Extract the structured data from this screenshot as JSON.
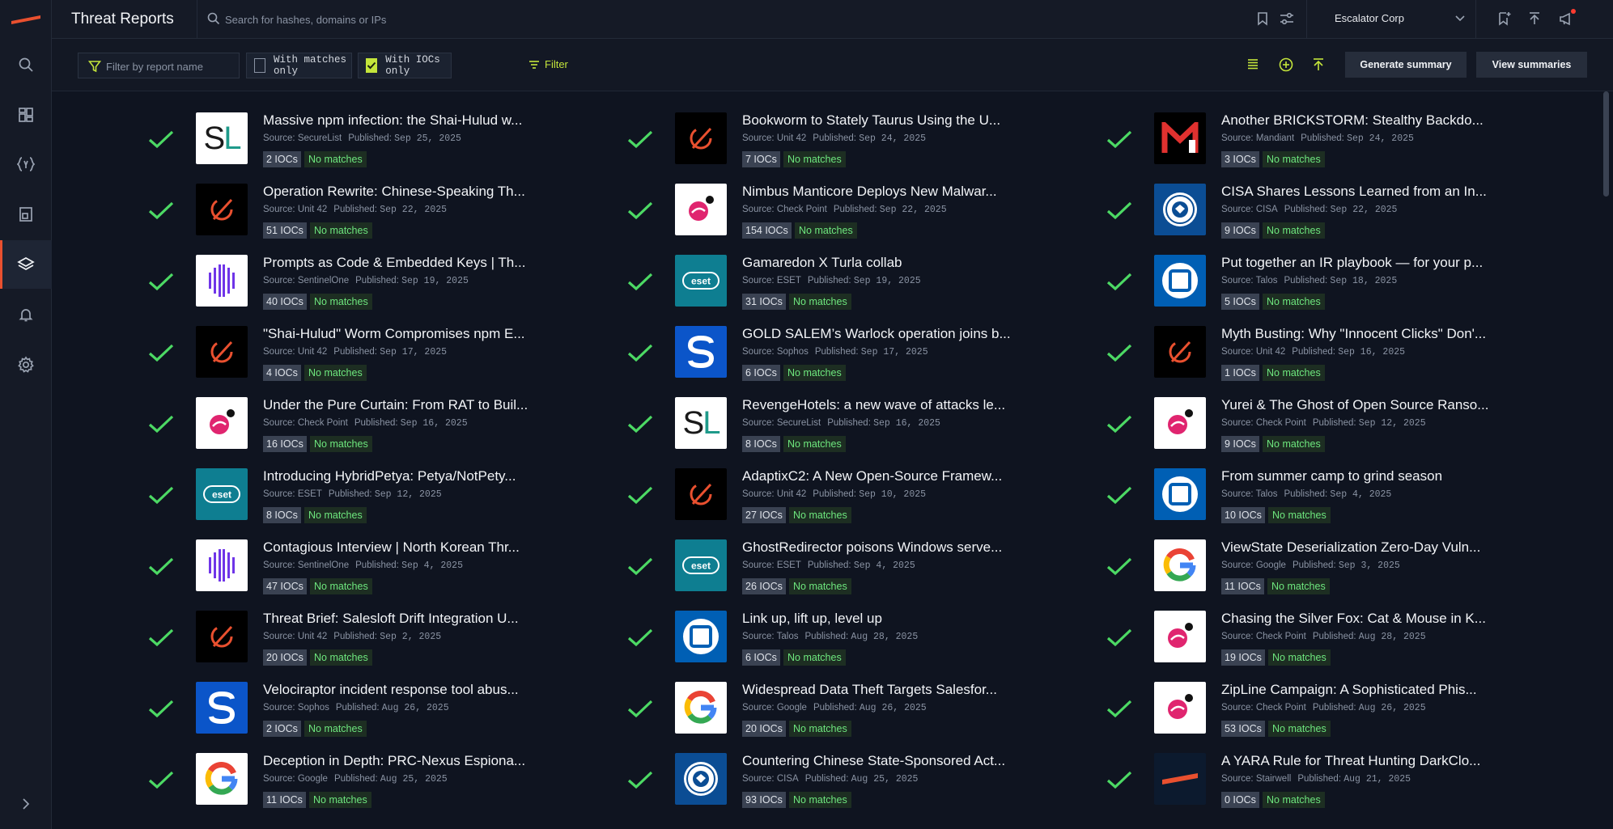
{
  "app": {
    "title": "Threat Reports",
    "search_placeholder": "Search for hashes, domains or IPs",
    "org_name": "Escalator Corp"
  },
  "nav": [
    "search-icon",
    "dashboard-icon",
    "rules-icon",
    "reports-icon",
    "layers-icon",
    "bell-icon",
    "gear-icon"
  ],
  "filters": {
    "report_name_placeholder": "Filter by report name",
    "with_matches_label": "With matches only",
    "with_matches_checked": false,
    "with_iocs_label": "With IOCs only",
    "with_iocs_checked": true,
    "filter_label": "Filter",
    "generate_summary_label": "Generate summary",
    "view_summaries_label": "View summaries"
  },
  "colors": {
    "accent": "#c4e53b",
    "check": "#4cd964",
    "no_match": "#6ee77e",
    "brand": "#e9502f"
  },
  "published_label": "Published:",
  "source_label": "Source:",
  "reports": [
    [
      {
        "title": "Massive npm infection: the Shai-Hulud w...",
        "source": "SecureList",
        "published": "Sep 25, 2025",
        "iocs": "2 IOCs",
        "matches": "No matches",
        "logo": "sl"
      },
      {
        "title": "Operation Rewrite: Chinese-Speaking Th...",
        "source": "Unit 42",
        "published": "Sep 22, 2025",
        "iocs": "51 IOCs",
        "matches": "No matches",
        "logo": "u42"
      },
      {
        "title": "Prompts as Code & Embedded Keys | Th...",
        "source": "SentinelOne",
        "published": "Sep 19, 2025",
        "iocs": "40 IOCs",
        "matches": "No matches",
        "logo": "s1"
      },
      {
        "title": "\"Shai-Hulud\" Worm Compromises npm E...",
        "source": "Unit 42",
        "published": "Sep 17, 2025",
        "iocs": "4 IOCs",
        "matches": "No matches",
        "logo": "u42"
      },
      {
        "title": "Under the Pure Curtain: From RAT to Buil...",
        "source": "Check Point",
        "published": "Sep 16, 2025",
        "iocs": "16 IOCs",
        "matches": "No matches",
        "logo": "cp"
      },
      {
        "title": "Introducing HybridPetya: Petya/NotPety...",
        "source": "ESET",
        "published": "Sep 12, 2025",
        "iocs": "8 IOCs",
        "matches": "No matches",
        "logo": "eset"
      },
      {
        "title": "Contagious Interview | North Korean Thr...",
        "source": "SentinelOne",
        "published": "Sep 4, 2025",
        "iocs": "47 IOCs",
        "matches": "No matches",
        "logo": "s1"
      },
      {
        "title": "Threat Brief: Salesloft Drift Integration U...",
        "source": "Unit 42",
        "published": "Sep 2, 2025",
        "iocs": "20 IOCs",
        "matches": "No matches",
        "logo": "u42"
      },
      {
        "title": "Velociraptor incident response tool abus...",
        "source": "Sophos",
        "published": "Aug 26, 2025",
        "iocs": "2 IOCs",
        "matches": "No matches",
        "logo": "sophos"
      },
      {
        "title": "Deception in Depth: PRC-Nexus Espiona...",
        "source": "Google",
        "published": "Aug 25, 2025",
        "iocs": "11 IOCs",
        "matches": "No matches",
        "logo": "google"
      }
    ],
    [
      {
        "title": "Bookworm to Stately Taurus Using the U...",
        "source": "Unit 42",
        "published": "Sep 24, 2025",
        "iocs": "7 IOCs",
        "matches": "No matches",
        "logo": "u42"
      },
      {
        "title": "Nimbus Manticore Deploys New Malwar...",
        "source": "Check Point",
        "published": "Sep 22, 2025",
        "iocs": "154 IOCs",
        "matches": "No matches",
        "logo": "cp"
      },
      {
        "title": "Gamaredon X Turla collab",
        "source": "ESET",
        "published": "Sep 19, 2025",
        "iocs": "31 IOCs",
        "matches": "No matches",
        "logo": "eset"
      },
      {
        "title": "GOLD SALEM’s Warlock operation joins b...",
        "source": "Sophos",
        "published": "Sep 17, 2025",
        "iocs": "6 IOCs",
        "matches": "No matches",
        "logo": "sophos"
      },
      {
        "title": "RevengeHotels: a new wave of attacks le...",
        "source": "SecureList",
        "published": "Sep 16, 2025",
        "iocs": "8 IOCs",
        "matches": "No matches",
        "logo": "sl"
      },
      {
        "title": "AdaptixC2: A New Open-Source Framew...",
        "source": "Unit 42",
        "published": "Sep 10, 2025",
        "iocs": "27 IOCs",
        "matches": "No matches",
        "logo": "u42"
      },
      {
        "title": "GhostRedirector poisons Windows serve...",
        "source": "ESET",
        "published": "Sep 4, 2025",
        "iocs": "26 IOCs",
        "matches": "No matches",
        "logo": "eset"
      },
      {
        "title": "Link up, lift up, level up",
        "source": "Talos",
        "published": "Aug 28, 2025",
        "iocs": "6 IOCs",
        "matches": "No matches",
        "logo": "talos"
      },
      {
        "title": "Widespread Data Theft Targets Salesfor...",
        "source": "Google",
        "published": "Aug 26, 2025",
        "iocs": "20 IOCs",
        "matches": "No matches",
        "logo": "google"
      },
      {
        "title": "Countering Chinese State-Sponsored Act...",
        "source": "CISA",
        "published": "Aug 25, 2025",
        "iocs": "93 IOCs",
        "matches": "No matches",
        "logo": "cisa"
      }
    ],
    [
      {
        "title": "Another BRICKSTORM: Stealthy Backdo...",
        "source": "Mandiant",
        "published": "Sep 24, 2025",
        "iocs": "3 IOCs",
        "matches": "No matches",
        "logo": "mandiant"
      },
      {
        "title": "CISA Shares Lessons Learned from an In...",
        "source": "CISA",
        "published": "Sep 22, 2025",
        "iocs": "9 IOCs",
        "matches": "No matches",
        "logo": "cisa"
      },
      {
        "title": "Put together an IR playbook — for your p...",
        "source": "Talos",
        "published": "Sep 18, 2025",
        "iocs": "5 IOCs",
        "matches": "No matches",
        "logo": "talos"
      },
      {
        "title": "Myth Busting: Why \"Innocent Clicks\" Don'...",
        "source": "Unit 42",
        "published": "Sep 16, 2025",
        "iocs": "1 IOCs",
        "matches": "No matches",
        "logo": "u42"
      },
      {
        "title": "Yurei & The Ghost of Open Source Ranso...",
        "source": "Check Point",
        "published": "Sep 12, 2025",
        "iocs": "9 IOCs",
        "matches": "No matches",
        "logo": "cp"
      },
      {
        "title": "From summer camp to grind season",
        "source": "Talos",
        "published": "Sep 4, 2025",
        "iocs": "10 IOCs",
        "matches": "No matches",
        "logo": "talos"
      },
      {
        "title": "ViewState Deserialization Zero-Day Vuln...",
        "source": "Google",
        "published": "Sep 3, 2025",
        "iocs": "11 IOCs",
        "matches": "No matches",
        "logo": "google"
      },
      {
        "title": "Chasing the Silver Fox: Cat & Mouse in K...",
        "source": "Check Point",
        "published": "Aug 28, 2025",
        "iocs": "19 IOCs",
        "matches": "No matches",
        "logo": "cp"
      },
      {
        "title": "ZipLine Campaign: A Sophisticated Phis...",
        "source": "Check Point",
        "published": "Aug 26, 2025",
        "iocs": "53 IOCs",
        "matches": "No matches",
        "logo": "cp"
      },
      {
        "title": "A YARA Rule for Threat Hunting DarkClo...",
        "source": "Stairwell",
        "published": "Aug 21, 2025",
        "iocs": "0 IOCs",
        "matches": "No matches",
        "logo": "stair"
      }
    ]
  ]
}
